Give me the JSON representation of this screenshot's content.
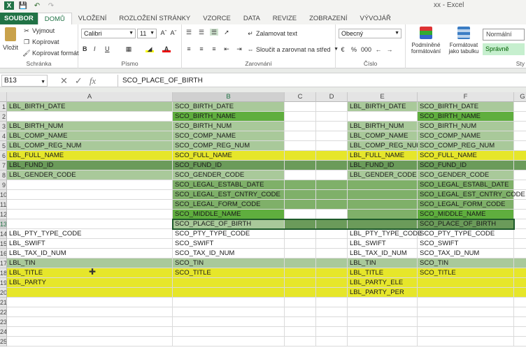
{
  "window": {
    "title": "xx - Excel"
  },
  "tabs": [
    {
      "label": "SOUBOR"
    },
    {
      "label": "DOMŮ"
    },
    {
      "label": "VLOŽENÍ"
    },
    {
      "label": "ROZLOŽENÍ STRÁNKY"
    },
    {
      "label": "VZORCE"
    },
    {
      "label": "DATA"
    },
    {
      "label": "REVIZE"
    },
    {
      "label": "ZOBRAZENÍ"
    },
    {
      "label": "VÝVOJÁŘ"
    }
  ],
  "ribbon": {
    "clipboard": {
      "paste": "Vložit",
      "cut": "Vyjmout",
      "copy": "Kopírovat",
      "format_painter": "Kopírovat formát",
      "group": "Schránka"
    },
    "font": {
      "name": "Calibri",
      "size": "11",
      "group": "Písmo",
      "bold": "B",
      "italic": "I",
      "underline": "U"
    },
    "alignment": {
      "wrap": "Zalamovat text",
      "merge": "Sloučit a zarovnat na střed",
      "group": "Zarovnání"
    },
    "number": {
      "format": "Obecný",
      "percent": "%",
      "thousands": "000",
      "group": "Číslo"
    },
    "styles": {
      "conditional": "Podmíněné formátování",
      "table": "Formátovat jako tabulku",
      "normal": "Normální",
      "good": "Správně",
      "group": "Sty"
    }
  },
  "formula_bar": {
    "name_box": "B13",
    "formula": "SCO_PLACE_OF_BIRTH"
  },
  "columns": [
    "A",
    "B",
    "C",
    "D",
    "E",
    "F",
    "G"
  ],
  "rows": [
    "1",
    "2",
    "3",
    "4",
    "5",
    "6",
    "7",
    "8",
    "9",
    "10",
    "11",
    "12",
    "13",
    "14",
    "15",
    "16",
    "17",
    "18",
    "19",
    "20",
    "21",
    "22",
    "23",
    "24",
    "25"
  ],
  "colors": {
    "excel_green": "#217346",
    "yellow": "#e6e62a",
    "dark_green": "#6b9b5a",
    "light_green": "#a9c99a",
    "mid_green": "#7fb069",
    "bright_green": "#5fae3e"
  },
  "cells": {
    "A1": "LBL_BIRTH_DATE",
    "B1": "SCO_BIRTH_DATE",
    "E1": "LBL_BIRTH_DATE",
    "F1": "SCO_BIRTH_DATE",
    "B2": "SCO_BIRTH_NAME",
    "F2": "SCO_BIRTH_NAME",
    "A3": "LBL_BIRTH_NUM",
    "B3": "SCO_BIRTH_NUM",
    "E3": "LBL_BIRTH_NUM",
    "F3": "SCO_BIRTH_NUM",
    "A4": "LBL_COMP_NAME",
    "B4": "SCO_COMP_NAME",
    "E4": "LBL_COMP_NAME",
    "F4": "SCO_COMP_NAME",
    "A5": "LBL_COMP_REG_NUM",
    "B5": "SCO_COMP_REG_NUM",
    "E5": "LBL_COMP_REG_NUM",
    "F5": "SCO_COMP_REG_NUM",
    "A6": "LBL_FULL_NAME",
    "B6": "SCO_FULL_NAME",
    "E6": "LBL_FULL_NAME",
    "F6": "SCO_FULL_NAME",
    "A7": "LBL_FUND_ID",
    "B7": "SCO_FUND_ID",
    "E7": "LBL_FUND_ID",
    "F7": "SCO_FUND_ID",
    "A8": "LBL_GENDER_CODE",
    "B8": "SCO_GENDER_CODE",
    "E8": "LBL_GENDER_CODE",
    "F8": "SCO_GENDER_CODE",
    "B9": "SCO_LEGAL_ESTABL_DATE",
    "F9": "SCO_LEGAL_ESTABL_DATE",
    "B10": "SCO_LEGAL_EST_CNTRY_CODE",
    "F10": "SCO_LEGAL_EST_CNTRY_CODE",
    "B11": "SCO_LEGAL_FORM_CODE",
    "F11": "SCO_LEGAL_FORM_CODE",
    "B12": "SCO_MIDDLE_NAME",
    "F12": "SCO_MIDDLE_NAME",
    "B13": "SCO_PLACE_OF_BIRTH",
    "F13": "SCO_PLACE_OF_BIRTH",
    "A14": "LBL_PTY_TYPE_CODE",
    "B14": "SCO_PTY_TYPE_CODE",
    "E14": "LBL_PTY_TYPE_CODE",
    "F14": "SCO_PTY_TYPE_CODE",
    "A15": "LBL_SWIFT",
    "B15": "SCO_SWIFT",
    "E15": "LBL_SWIFT",
    "F15": "SCO_SWIFT",
    "A16": "LBL_TAX_ID_NUM",
    "B16": "SCO_TAX_ID_NUM",
    "E16": "LBL_TAX_ID_NUM",
    "F16": "SCO_TAX_ID_NUM",
    "A17": "LBL_TIN",
    "B17": "SCO_TIN",
    "E17": "LBL_TIN",
    "F17": "SCO_TIN",
    "A18": "LBL_TITLE",
    "B18": "SCO_TITLE",
    "E18": "LBL_TITLE",
    "F18": "SCO_TITLE",
    "A19": "LBL_PARTY",
    "E19": "LBL_PARTY_ELE",
    "E20": "LBL_PARTY_PER"
  }
}
